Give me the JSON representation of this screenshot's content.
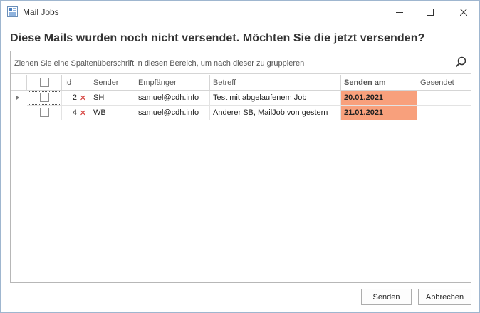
{
  "window": {
    "title": "Mail Jobs"
  },
  "heading": "Diese Mails wurden noch nicht versendet. Möchten Sie die jetzt versenden?",
  "group_panel": {
    "hint": "Ziehen Sie eine Spaltenüberschrift in diesen Bereich, um nach dieser zu gruppieren"
  },
  "columns": {
    "id": "Id",
    "sender": "Sender",
    "recipient": "Empfänger",
    "subject": "Betreff",
    "send_date": "Senden am",
    "sent": "Gesendet"
  },
  "rows": [
    {
      "id": "2",
      "sender": "SH",
      "recipient": "samuel@cdh.info",
      "subject": "Test mit abgelaufenem Job",
      "send_date": "20.01.2021",
      "sent": ""
    },
    {
      "id": "4",
      "sender": "WB",
      "recipient": "samuel@cdh.info",
      "subject": "Anderer SB, MailJob von gestern",
      "send_date": "21.01.2021",
      "sent": ""
    }
  ],
  "buttons": {
    "send": "Senden",
    "cancel": "Abbrechen"
  },
  "colors": {
    "highlight_date": "#f8a07c",
    "delete_icon": "#d2302c"
  },
  "icons": {
    "app": "mail-jobs-app-icon",
    "search": "search-icon",
    "delete": "x-icon"
  }
}
